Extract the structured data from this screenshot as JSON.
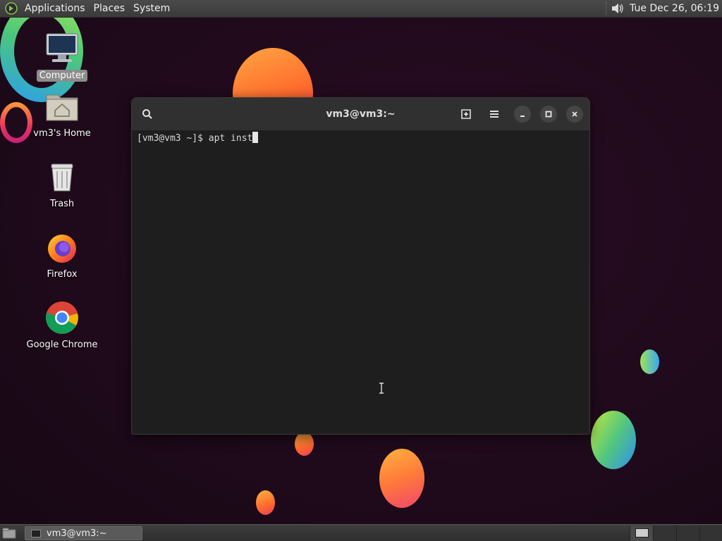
{
  "top_panel": {
    "menus": [
      "Applications",
      "Places",
      "System"
    ],
    "clock": "Tue Dec 26, 06:19",
    "volume_icon": "speaker-icon"
  },
  "desktop": {
    "icons": [
      {
        "label": "Computer",
        "icon": "computer-icon",
        "selected": true
      },
      {
        "label": "vm3's Home",
        "icon": "home-folder-icon",
        "selected": false
      },
      {
        "label": "Trash",
        "icon": "trash-icon",
        "selected": false
      },
      {
        "label": "Firefox",
        "icon": "firefox-icon",
        "selected": false
      },
      {
        "label": "Google Chrome",
        "icon": "chrome-icon",
        "selected": false
      }
    ]
  },
  "terminal": {
    "title": "vm3@vm3:~",
    "prompt": "[vm3@vm3 ~]$ ",
    "input": "apt inst",
    "header_buttons": [
      "search-icon",
      "new-tab-icon",
      "hamburger-menu-icon",
      "minimize-icon",
      "maximize-icon",
      "close-icon"
    ]
  },
  "bottom_panel": {
    "task_label": "vm3@vm3:~",
    "workspaces": 4,
    "active_workspace": 1
  },
  "colors": {
    "panel": "#3a3a3a",
    "terminal_bg": "#1e1e1e",
    "header_bg": "#303030",
    "desktop_bg": "#1f0a1b"
  }
}
